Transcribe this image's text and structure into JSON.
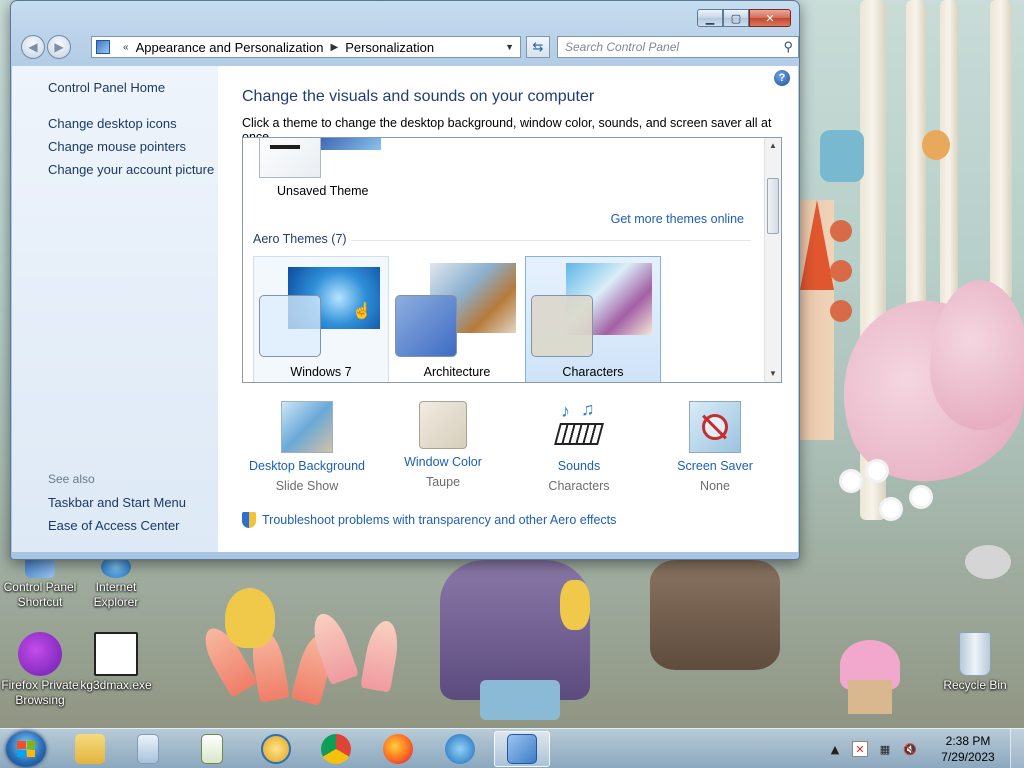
{
  "window": {
    "address": {
      "parent": "Appearance and Personalization",
      "current": "Personalization"
    },
    "search_placeholder": "Search Control Panel"
  },
  "sidebar": {
    "home": "Control Panel Home",
    "links": [
      "Change desktop icons",
      "Change mouse pointers",
      "Change your account picture"
    ],
    "see_also_label": "See also",
    "see_also": [
      "Taskbar and Start Menu",
      "Ease of Access Center"
    ]
  },
  "main": {
    "heading": "Change the visuals and sounds on your computer",
    "subtext": "Click a theme to change the desktop background, window color, sounds, and screen saver all at once.",
    "unsaved_theme": "Unsaved Theme",
    "get_more": "Get more themes online",
    "group_label": "Aero Themes (7)",
    "themes": [
      "Windows 7",
      "Architecture",
      "Characters"
    ],
    "bottom": [
      {
        "title": "Desktop Background",
        "value": "Slide Show"
      },
      {
        "title": "Window Color",
        "value": "Taupe"
      },
      {
        "title": "Sounds",
        "value": "Characters"
      },
      {
        "title": "Screen Saver",
        "value": "None"
      }
    ],
    "troubleshoot": "Troubleshoot problems with transparency and other Aero effects"
  },
  "desktop_icons": [
    {
      "label": "Control Panel Shortcut"
    },
    {
      "label": "Internet Explorer"
    },
    {
      "label": "Firefox Private Browsing"
    },
    {
      "label": "kg3dmax.exe"
    },
    {
      "label": "Recycle Bin"
    }
  ],
  "taskbar": {
    "clock_time": "2:38 PM",
    "clock_date": "7/29/2023"
  }
}
